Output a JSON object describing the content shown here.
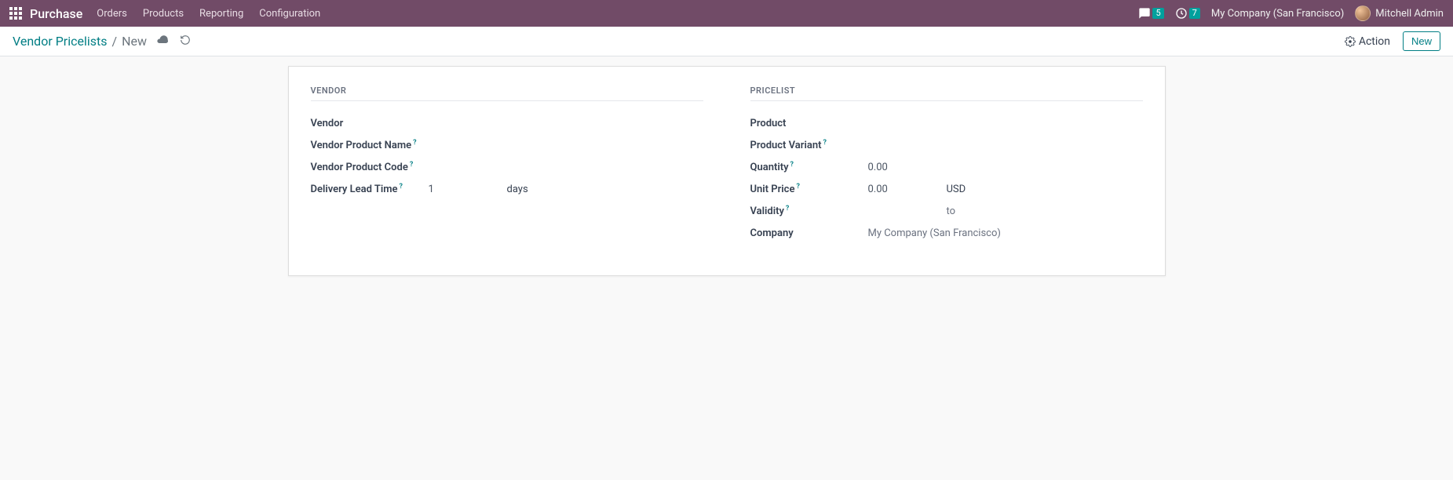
{
  "navbar": {
    "brand": "Purchase",
    "menu": [
      "Orders",
      "Products",
      "Reporting",
      "Configuration"
    ],
    "messages_badge": "5",
    "activities_badge": "7",
    "company": "My Company (San Francisco)",
    "user": "Mitchell Admin"
  },
  "controlbar": {
    "breadcrumb_parent": "Vendor Pricelists",
    "breadcrumb_sep": "/",
    "breadcrumb_current": "New",
    "action_label": "Action",
    "new_label": "New"
  },
  "form": {
    "vendor_section": {
      "title": "VENDOR",
      "vendor_label": "Vendor",
      "vendor_product_name_label": "Vendor Product Name",
      "vendor_product_code_label": "Vendor Product Code",
      "delivery_lead_time_label": "Delivery Lead Time",
      "delivery_lead_time_value": "1",
      "delivery_lead_time_unit": "days"
    },
    "pricelist_section": {
      "title": "PRICELIST",
      "product_label": "Product",
      "product_variant_label": "Product Variant",
      "quantity_label": "Quantity",
      "quantity_value": "0.00",
      "unit_price_label": "Unit Price",
      "unit_price_value": "0.00",
      "unit_price_currency": "USD",
      "validity_label": "Validity",
      "validity_to": "to",
      "company_label": "Company",
      "company_value": "My Company (San Francisco)"
    }
  },
  "help_mark": "?"
}
